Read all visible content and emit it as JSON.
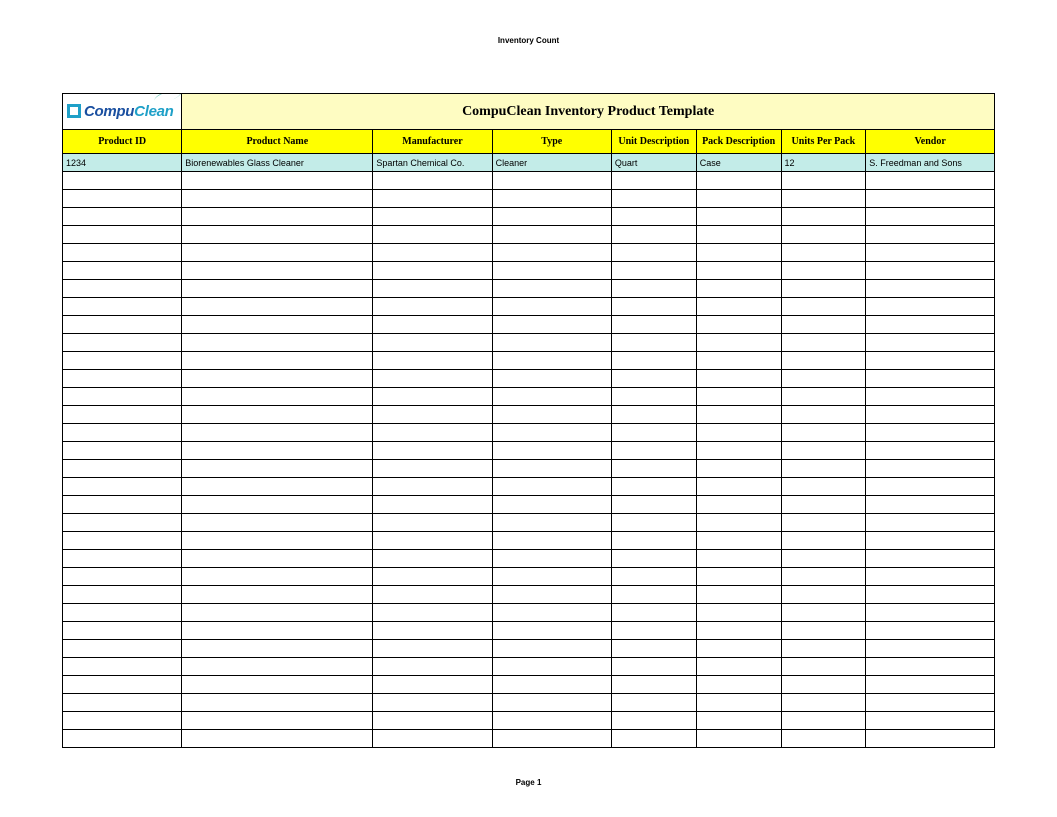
{
  "page_header": "Inventory Count",
  "page_footer": "Page 1",
  "logo": {
    "prefix": "Compu",
    "suffix": "Clean"
  },
  "title": "CompuClean Inventory Product Template",
  "columns": [
    "Product ID",
    "Product Name",
    "Manufacturer",
    "Type",
    "Unit Description",
    "Pack Description",
    "Units Per Pack",
    "Vendor"
  ],
  "rows": [
    {
      "product_id": "1234",
      "product_name": "Biorenewables Glass Cleaner",
      "manufacturer": "Spartan Chemical Co.",
      "type": "Cleaner",
      "unit_description": "Quart",
      "pack_description": "Case",
      "units_per_pack": "12",
      "vendor": "S. Freedman and Sons"
    }
  ],
  "empty_row_count": 32,
  "col_widths_pct": [
    12.8,
    20.5,
    12.8,
    12.8,
    9.1,
    9.1,
    9.1,
    13.8
  ]
}
